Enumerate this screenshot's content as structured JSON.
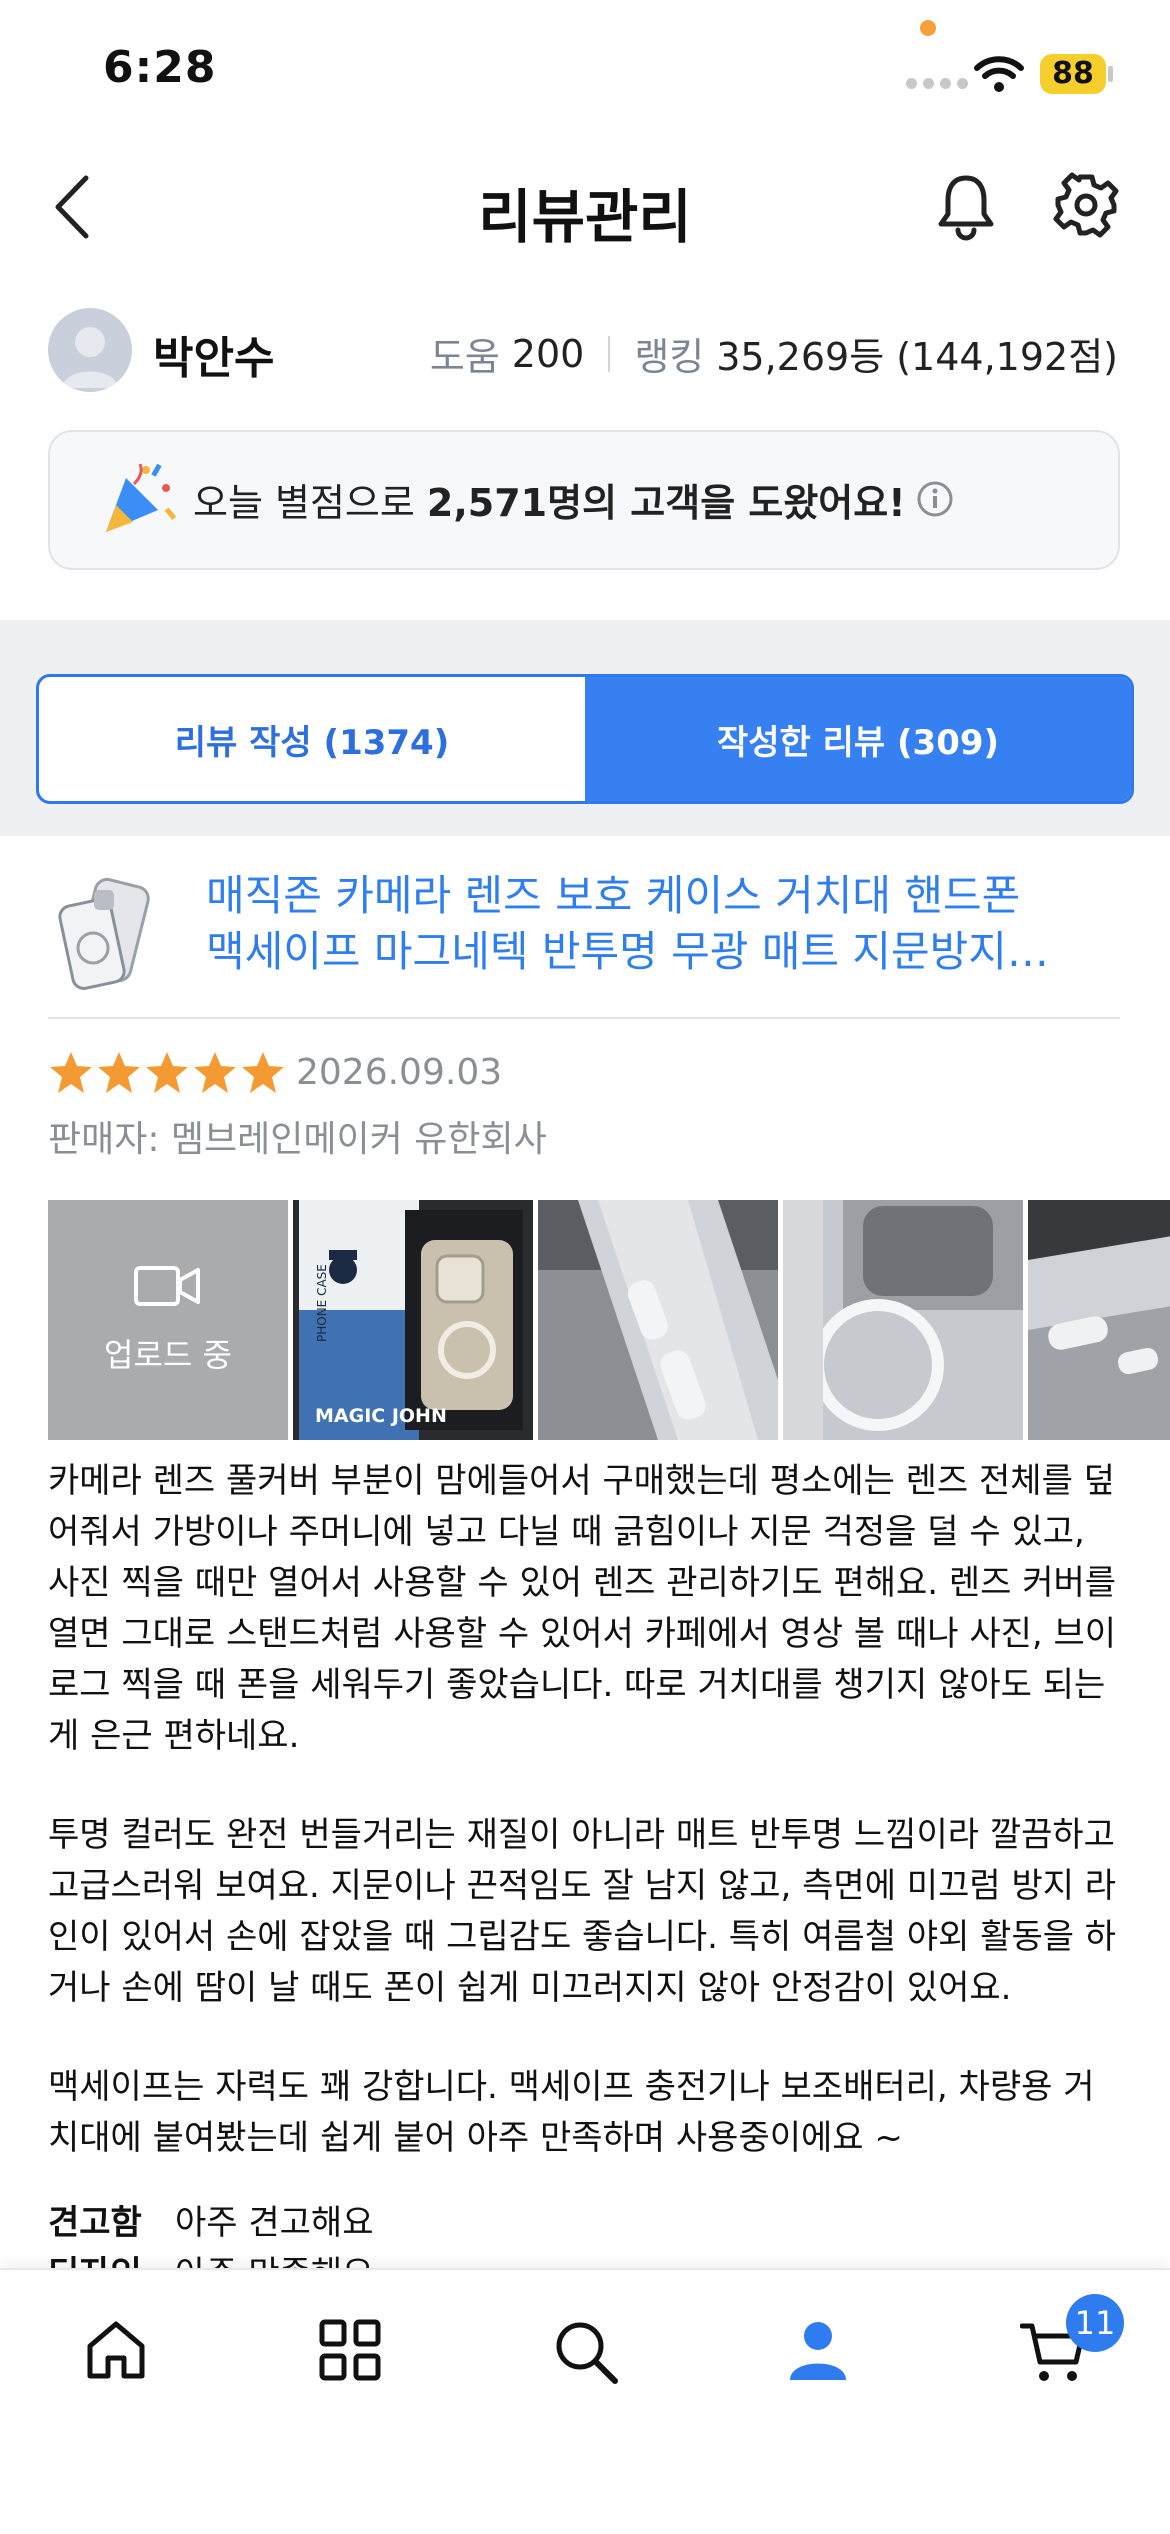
{
  "status_bar": {
    "time": "6:28",
    "battery": "88"
  },
  "header": {
    "title": "리뷰관리"
  },
  "profile": {
    "name": "박안수",
    "help_label": "도움",
    "help_value": "200",
    "rank_label": "랭킹",
    "rank_value": "35,269등 (144,192점)"
  },
  "banner": {
    "prefix": "오늘 별점으로 ",
    "count": "2,571",
    "suffix": "명의 고객을 도왔어요!"
  },
  "tabs": [
    {
      "label": "리뷰 작성 (1374)",
      "selected": false
    },
    {
      "label": "작성한 리뷰 (309)",
      "selected": true
    }
  ],
  "product": {
    "title_line1": "매직존 카메라 렌즈 보호 케이스 거치대 핸드폰",
    "title_line2": "맥세이프 마그네텍 반투명 무광 매트 지문방지…",
    "rating": 5,
    "date": "2026.09.03",
    "seller": "판매자: 멤브레인메이커 유한회사"
  },
  "photos": {
    "upload_label": "업로드 중",
    "box_text_1": "PHONE CASE",
    "box_text_2": "MAGIC JOHN"
  },
  "review": {
    "paragraphs": [
      "카메라 렌즈 풀커버 부분이 맘에들어서 구매했는데 평소에는 렌즈 전체를 덮어줘서 가방이나 주머니에 넣고 다닐 때 긁힘이나 지문 걱정을 덜 수 있고, 사진 찍을 때만 열어서 사용할 수 있어 렌즈 관리하기도 편해요. 렌즈 커버를 열면 그대로 스탠드처럼 사용할 수 있어서 카페에서 영상 볼 때나 사진, 브이로그 찍을 때 폰을 세워두기 좋았습니다. 따로 거치대를 챙기지 않아도 되는 게 은근 편하네요.",
      "투명 컬러도 완전 번들거리는 재질이 아니라 매트 반투명 느낌이라 깔끔하고 고급스러워 보여요. 지문이나 끈적임도 잘 남지 않고, 측면에 미끄럼 방지 라인이 있어서 손에 잡았을 때 그립감도 좋습니다. 특히 여름철 야외 활동을 하거나 손에 땀이 날 때도 폰이 쉽게 미끄러지지 않아 안정감이 있어요.",
      "맥세이프는  자력도 꽤 강합니다. 맥세이프 충전기나 보조배터리, 차량용 거치대에 붙여봤는데 쉽게 붙어 아주 만족하며 사용중이에요 ~"
    ],
    "criteria": [
      {
        "key": "견고함",
        "value": "아주 견고해요"
      },
      {
        "key": "디자인",
        "value": "아주 만족해요"
      }
    ]
  },
  "bottom_nav": {
    "cart_count": "11"
  },
  "colors": {
    "accent": "#2e7cf0",
    "star": "#f39a33",
    "battery": "#f6cf2c"
  }
}
